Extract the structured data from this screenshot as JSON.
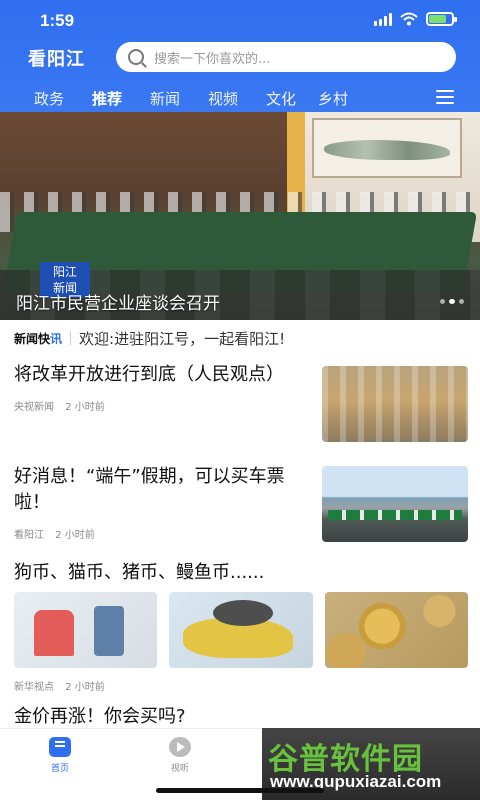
{
  "status_bar": {
    "time": "1:59"
  },
  "header": {
    "brand": "看阳江",
    "search_placeholder": "搜索一下你喜欢的...",
    "tabs": [
      {
        "label": "政务"
      },
      {
        "label": "推荐",
        "active": true
      },
      {
        "label": "新闻"
      },
      {
        "label": "视频"
      },
      {
        "label": "文化"
      },
      {
        "label": "乡村"
      }
    ],
    "accent_color": "#2f6ff0"
  },
  "banner": {
    "caption": "阳江市民营企业座谈会召开",
    "logo_text": "阳江\n新闻",
    "dots": 3,
    "active_dot": 1
  },
  "flash": {
    "logo_part1": "新闻快",
    "logo_part2": "讯",
    "text": "欢迎:进驻阳江号，一起看阳江!"
  },
  "articles": [
    {
      "title": "将改革开放进行到底（人民观点）",
      "source": "央视新闻",
      "time": "2 小时前"
    },
    {
      "title": "好消息！“端午”假期，可以买车票啦！",
      "source": "看阳江",
      "time": "2 小时前"
    },
    {
      "title": "狗币、猫币、猪币、鳗鱼币......",
      "source": "新华视点",
      "time": "2 小时前"
    },
    {
      "title": "金价再涨！你会买吗?"
    }
  ],
  "bottom_nav": {
    "home_label": "首页",
    "video_label": "视听"
  },
  "watermark": {
    "title": "谷普软件园",
    "url": "www.gupuxiazai.com"
  }
}
